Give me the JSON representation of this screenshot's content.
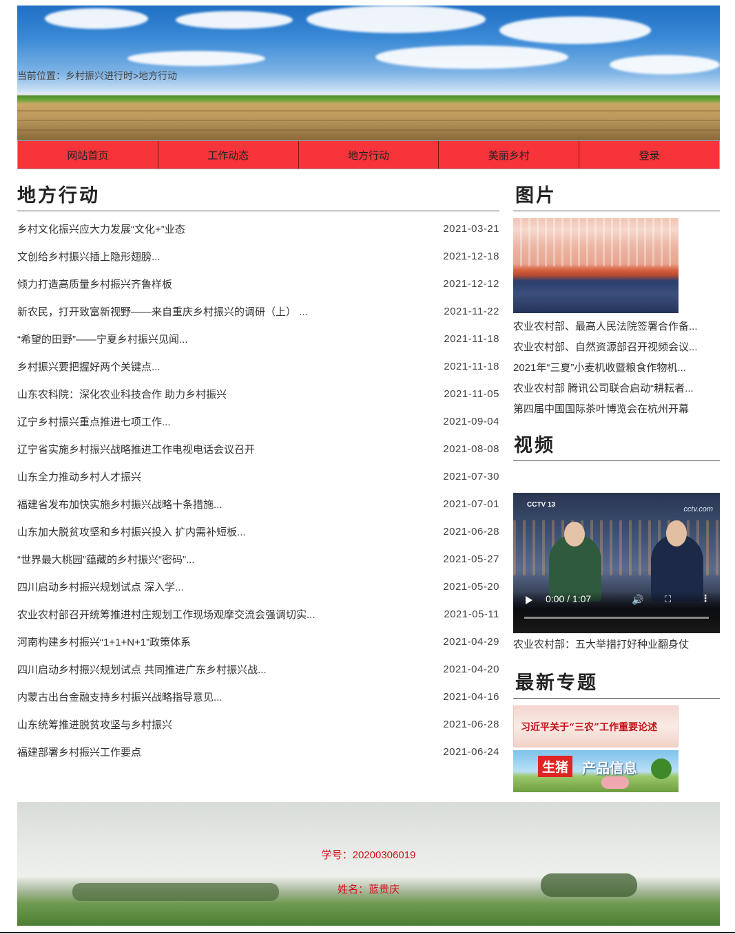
{
  "breadcrumb": "当前位置：乡村振兴进行时>地方行动",
  "nav": {
    "items": [
      "网站首页",
      "工作动态",
      "地方行动",
      "美丽乡村",
      "登录"
    ],
    "bg_color": "#f7343a"
  },
  "left_section": {
    "title": "地方行动",
    "news": [
      {
        "title": "乡村文化振兴应大力发展“文化+”业态",
        "date": "2021-03-21"
      },
      {
        "title": "文创给乡村振兴插上隐形翅膀...",
        "date": "2021-12-18"
      },
      {
        "title": "倾力打造高质量乡村振兴齐鲁样板",
        "date": "2021-12-12"
      },
      {
        "title": "新农民，打开致富新视野——来自重庆乡村振兴的调研（上） ...",
        "date": "2021-11-22"
      },
      {
        "title": "“希望的田野”——宁夏乡村振兴见闻...",
        "date": "2021-11-18"
      },
      {
        "title": "乡村振兴要把握好两个关键点...",
        "date": "2021-11-18"
      },
      {
        "title": "山东农科院：深化农业科技合作 助力乡村振兴",
        "date": "2021-11-05"
      },
      {
        "title": "辽宁乡村振兴重点推进七项工作...",
        "date": "2021-09-04"
      },
      {
        "title": "辽宁省实施乡村振兴战略推进工作电视电话会议召开",
        "date": "2021-08-08"
      },
      {
        "title": "山东全力推动乡村人才振兴",
        "date": "2021-07-30"
      },
      {
        "title": "福建省发布加快实施乡村振兴战略十条措施...",
        "date": "2021-07-01"
      },
      {
        "title": "山东加大脱贫攻坚和乡村振兴投入 扩内需补短板...",
        "date": "2021-06-28"
      },
      {
        "title": "“世界最大桃园”蕴藏的乡村振兴“密码”...",
        "date": "2021-05-27"
      },
      {
        "title": "四川启动乡村振兴规划试点 深入学...",
        "date": "2021-05-20"
      },
      {
        "title": "农业农村部召开统筹推进村庄规划工作现场观摩交流会强调切实...",
        "date": "2021-05-11"
      },
      {
        "title": "河南构建乡村振兴“1+1+N+1”政策体系",
        "date": "2021-04-29"
      },
      {
        "title": "四川启动乡村振兴规划试点 共同推进广东乡村振兴战...",
        "date": "2021-04-20"
      },
      {
        "title": "内蒙古出台金融支持乡村振兴战略指导意见...",
        "date": "2021-04-16"
      },
      {
        "title": "山东统筹推进脱贫攻坚与乡村振兴",
        "date": "2021-06-28"
      },
      {
        "title": "福建部署乡村振兴工作要点",
        "date": "2021-06-24"
      }
    ]
  },
  "pictures": {
    "title": "图片",
    "items": [
      "农业农村部、最高人民法院签署合作备...",
      "农业农村部、自然资源部召开视频会议...",
      "2021年“三夏”小麦机收暨粮食作物机...",
      "农业农村部 腾讯公司联合启动“耕耘者...",
      "第四届中国国际茶叶博览会在杭州开幕"
    ]
  },
  "video": {
    "title": "视频",
    "logo_left": "CCTV 13",
    "logo_right": "cctv.com",
    "time": "0:00 / 1:07",
    "caption": "农业农村部：五大举措打好种业翻身仗",
    "play_icon": "play-icon",
    "volume_icon": "volume-icon",
    "fullscreen_icon": "fullscreen-icon",
    "more_icon": "more-icon"
  },
  "topics": {
    "title": "最新专题",
    "banner1": "习近平关于“三农”工作重要论述",
    "banner2_tag": "生猪",
    "banner2_text": "产品信息"
  },
  "footer": {
    "student_id": "学号：20200306019",
    "name": "姓名：蓝贵庆",
    "text_color": "#d0141a"
  }
}
